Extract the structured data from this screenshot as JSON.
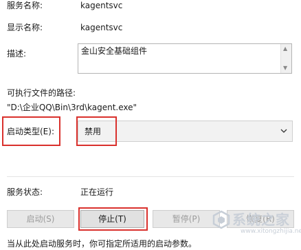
{
  "service_name": {
    "label": "服务名称:",
    "value": "kagentsvc"
  },
  "display_name": {
    "label": "显示名称:",
    "value": "kagentsvc"
  },
  "description": {
    "label": "描述:",
    "value": "金山安全基础组件"
  },
  "executable_path": {
    "label": "可执行文件的路径:",
    "value": "\"D:\\企业QQ\\Bin\\3rd\\kagent.exe\""
  },
  "startup_type": {
    "label": "启动类型(E):",
    "selected": "禁用"
  },
  "service_status": {
    "label": "服务状态:",
    "value": "正在运行"
  },
  "buttons": {
    "start": "启动(S)",
    "stop": "停止(T)",
    "pause": "暂停(P)",
    "resume": "恢复(R)"
  },
  "hint_text": "当从此处启动服务时，你可指定所适用的启动参数。",
  "watermark": {
    "text": "系统之家",
    "url": "www.xitongzhijia.net"
  },
  "colors": {
    "highlight": "#d9302c",
    "disabled_text": "#9c9c9c"
  }
}
